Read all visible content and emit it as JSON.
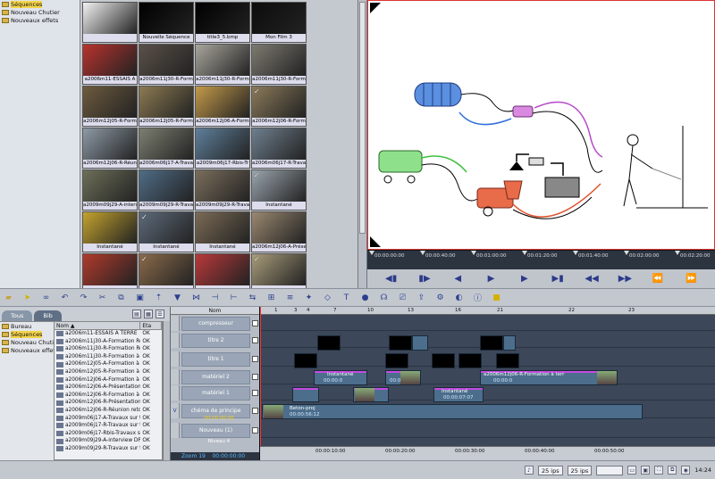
{
  "tree_top": [
    {
      "label": "Séquences",
      "selected": true
    },
    {
      "label": "Nouveau Chutier",
      "selected": false
    },
    {
      "label": "Nouveaux effets",
      "selected": false
    }
  ],
  "thumbs": [
    {
      "caption": "",
      "checked": false,
      "color": "#f2f2f2"
    },
    {
      "caption": "Nouvelle Séquence",
      "checked": false,
      "color": "#000000"
    },
    {
      "caption": "title3_5.bmp",
      "checked": false,
      "color": "#000000"
    },
    {
      "caption": "Mon Film 3",
      "checked": false,
      "color": "#0c0c0c"
    },
    {
      "caption": "a2006m11-ESSAIS A",
      "checked": false,
      "color": "#b8332e"
    },
    {
      "caption": "a2006m11j30-R-Form",
      "checked": false,
      "color": "#5a5048"
    },
    {
      "caption": "a2006m11j30-R-Form",
      "checked": false,
      "color": "#a8a69c"
    },
    {
      "caption": "a2006m11j30-R-Form",
      "checked": false,
      "color": "#7d7a70"
    },
    {
      "caption": "a2006m12j05-R-Form",
      "checked": false,
      "color": "#6d5b3e"
    },
    {
      "caption": "a2006m12j05-R-Form",
      "checked": false,
      "color": "#8c7a52"
    },
    {
      "caption": "a2006m12j06-A-Form",
      "checked": false,
      "color": "#c49a4a"
    },
    {
      "caption": "a2006m12j06-R-Form",
      "checked": true,
      "color": "#8b7a5a"
    },
    {
      "caption": "a2006m12j06-R-Réun",
      "checked": false,
      "color": "#8e9aa6"
    },
    {
      "caption": "a2006m06j17-A-Trava",
      "checked": false,
      "color": "#7c7f70"
    },
    {
      "caption": "a2009m06j17-Rbis-Tr",
      "checked": false,
      "color": "#5e7f9a"
    },
    {
      "caption": "a2006m06j17-R-Trava",
      "checked": false,
      "color": "#6f7f8e"
    },
    {
      "caption": "a2009m09j29-A-interv",
      "checked": false,
      "color": "#6d6f58"
    },
    {
      "caption": "a2009m09j29-R-Trava",
      "checked": false,
      "color": "#4f6c86"
    },
    {
      "caption": "a2009m09j29-R-Trava",
      "checked": false,
      "color": "#7a6e5c"
    },
    {
      "caption": "Instantané",
      "checked": true,
      "color": "#9aa4ad"
    },
    {
      "caption": "Instantané",
      "checked": false,
      "color": "#c4a32e"
    },
    {
      "caption": "Instantané",
      "checked": true,
      "color": "#5d6a7a"
    },
    {
      "caption": "Instantané",
      "checked": false,
      "color": "#7b6b55"
    },
    {
      "caption": "a2006m12j06-A-Prése",
      "checked": false,
      "color": "#9a8870"
    },
    {
      "caption": "",
      "checked": false,
      "color": "#b03a2c"
    },
    {
      "caption": "",
      "checked": true,
      "color": "#8a6a4a"
    },
    {
      "caption": "",
      "checked": false,
      "color": "#b8393a"
    },
    {
      "caption": "",
      "checked": true,
      "color": "#a89c7a"
    }
  ],
  "ruler": {
    "marks": [
      "00:00:00:00",
      "00:00:40:00",
      "00:01:00:00",
      "00:01:20:00",
      "00:01:40:00",
      "00:02:00:00",
      "00:02:20:00"
    ]
  },
  "bin": {
    "tabs": [
      "Tous",
      "Bib"
    ],
    "tree": [
      {
        "label": "Bureau",
        "selected": false
      },
      {
        "label": "Séquences",
        "selected": true
      },
      {
        "label": "Nouveau Chutier",
        "selected": false
      },
      {
        "label": "Nouveaux effets",
        "selected": false
      }
    ],
    "col_name": "Nom ▲",
    "col_status": "Eta",
    "rows": [
      {
        "name": "a2006m11-ESSAIS A TERRE",
        "status": "OK"
      },
      {
        "name": "a2006m11j30-A-Formation Réunio",
        "status": "OK"
      },
      {
        "name": "a2006m11j30-R-Formation Réunio",
        "status": "OK"
      },
      {
        "name": "a2006m11j30-R-Formation à terr",
        "status": "OK"
      },
      {
        "name": "a2006m12j05-A-Formation à terr",
        "status": "OK"
      },
      {
        "name": "a2006m12j05-R-Formation à terr",
        "status": "OK"
      },
      {
        "name": "a2006m12j06-A-Formation à terr",
        "status": "OK"
      },
      {
        "name": "a2006m12j06-A-Présentation mac",
        "status": "OK"
      },
      {
        "name": "a2006m12j06-R-Formation à terr",
        "status": "OK"
      },
      {
        "name": "a2006m12j06-R-Présentation mac",
        "status": "OK"
      },
      {
        "name": "a2006m12j06-R-Réunion retour f",
        "status": "OK"
      },
      {
        "name": "a2009m06j17-A-Travaux sur tour",
        "status": "OK"
      },
      {
        "name": "a2009m06j17-R-Travaux sur tour",
        "status": "OK"
      },
      {
        "name": "a2009m06j17-Rbis-Travaux sur t",
        "status": "OK"
      },
      {
        "name": "a2009m09j29-A-interview DPA",
        "status": "OK"
      },
      {
        "name": "a2009m09j29-R-Travaux sur tour",
        "status": "OK"
      }
    ]
  },
  "timeline": {
    "col_header": "Nom",
    "tracks": [
      {
        "name": "compresseur",
        "lock": ""
      },
      {
        "name": "titre 2",
        "lock": ""
      },
      {
        "name": "titre 1",
        "lock": ""
      },
      {
        "name": "matériel 2",
        "lock": ""
      },
      {
        "name": "matériel 1",
        "lock": ""
      },
      {
        "name": "chéma de principe",
        "lock": "V"
      },
      {
        "name": "Nouveau (1)",
        "lock": ""
      }
    ],
    "chema_tc": "00:00:00:00",
    "niveau_label": "Niveau 4",
    "zoom_label": "Zoom 19",
    "zoom_tc": "00:00:00:00",
    "ruler_numbers": [
      "1",
      "3",
      "4",
      "7",
      "10",
      "13",
      "16",
      "21",
      "22",
      "23"
    ],
    "bottom_marks": [
      "00:00:10:00",
      "00:00:20:00",
      "00:00:30:00",
      "00:00:40:00",
      "00:00:50:00"
    ],
    "clip_instantane": "Instantané",
    "clip_instantane_tc": "00:00:0",
    "clip_formation": "a2006m12j06-R-Formation à terr",
    "clip_formation_tc": "00:00:20:09",
    "clip_instantane2_tc": "00:00:07:07",
    "clip_beton": "Beton-proj",
    "clip_beton_tc": "00:00:56:12",
    "clip_zero": "00:0"
  },
  "status": {
    "fps1": "25 ips",
    "fps2": "25 ips",
    "time": "14:24"
  }
}
